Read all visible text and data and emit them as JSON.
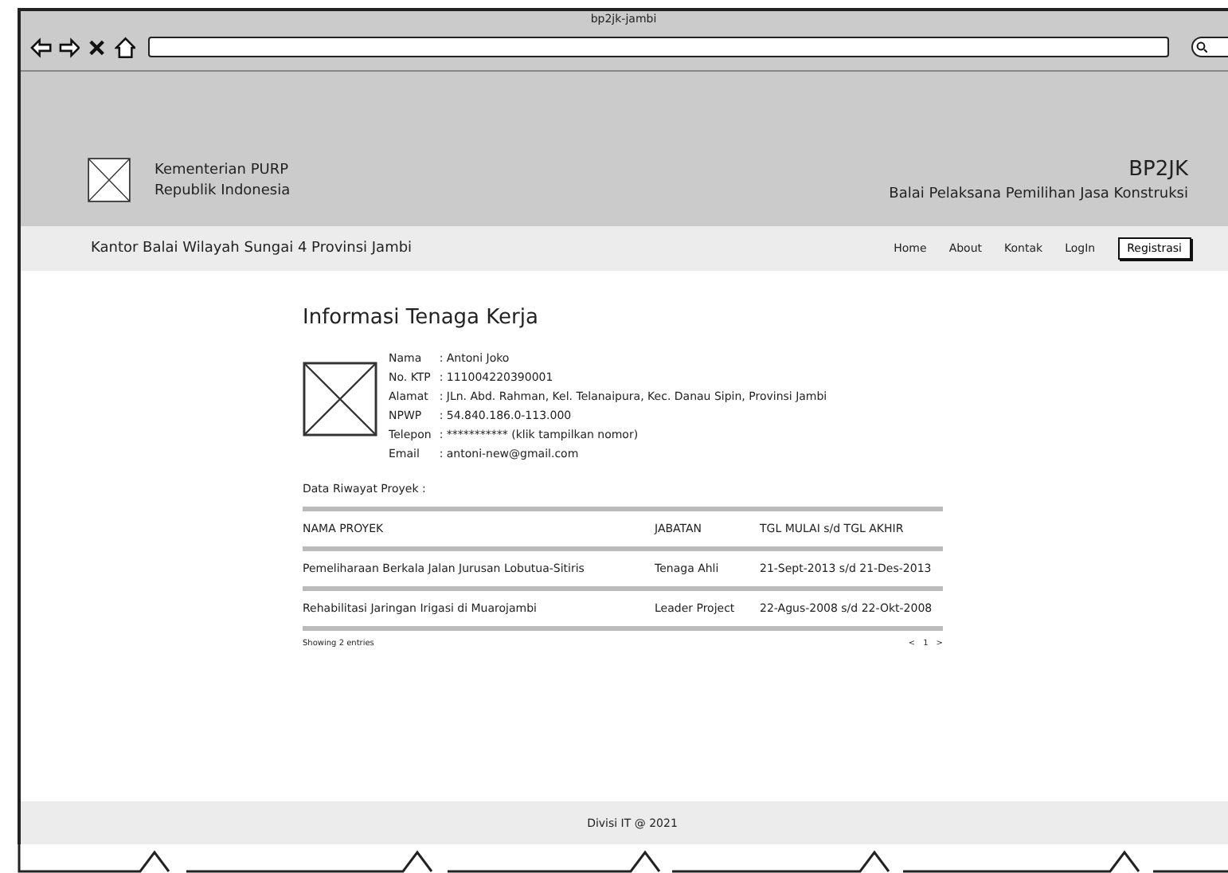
{
  "browser": {
    "title": "bp2jk-jambi"
  },
  "header": {
    "org_line_1": "Kementerian PURP",
    "org_line_2": "Republik Indonesia",
    "brand": "BP2JK",
    "brand_subtitle": "Balai Pelaksana Pemilihan Jasa Konstruksi"
  },
  "navbar": {
    "title": "Kantor Balai Wilayah Sungai 4 Provinsi Jambi",
    "links": [
      {
        "label": "Home",
        "kind": "link"
      },
      {
        "label": "About",
        "kind": "link"
      },
      {
        "label": "Kontak",
        "kind": "link"
      },
      {
        "label": "LogIn",
        "kind": "link"
      },
      {
        "label": "Registrasi",
        "kind": "button"
      }
    ]
  },
  "profile": {
    "title": "Informasi Tenaga Kerja",
    "fields": [
      {
        "label": "Nama",
        "value": ": Antoni Joko"
      },
      {
        "label": "No. KTP",
        "value": ": 111004220390001"
      },
      {
        "label": "Alamat",
        "value": ": JLn. Abd. Rahman, Kel. Telanaipura, Kec. Danau Sipin, Provinsi Jambi"
      },
      {
        "label": "NPWP",
        "value": ": 54.840.186.0-113.000"
      },
      {
        "label": "Telepon",
        "value": ": *********** (klik tampilkan nomor)"
      },
      {
        "label": "Email",
        "value": ": antoni-new@gmail.com"
      }
    ]
  },
  "projects": {
    "title": "Data Riwayat Proyek :",
    "columns": [
      "NAMA PROYEK",
      "JABATAN",
      "TGL MULAI s/d TGL AKHIR"
    ],
    "rows": [
      [
        "Pemeliharaan Berkala Jalan Jurusan Lobutua-Sitiris",
        "Tenaga Ahli",
        "21-Sept-2013 s/d 21-Des-2013"
      ],
      [
        "Rehabilitasi Jaringan Irigasi di Muarojambi",
        "Leader Project",
        "22-Agus-2008 s/d 22-Okt-2008"
      ]
    ],
    "info": "Showing 2 entries",
    "pager": [
      "<",
      "1",
      ">"
    ]
  },
  "footer": {
    "text": "Divisi IT @ 2021"
  }
}
